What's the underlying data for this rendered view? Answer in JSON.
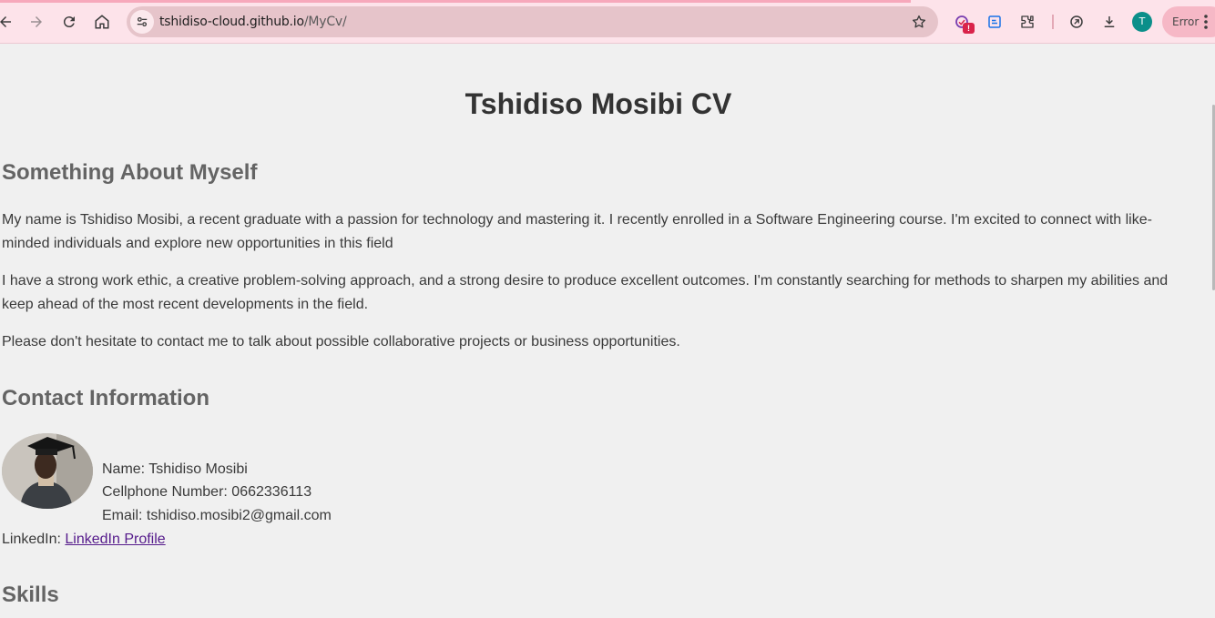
{
  "browser": {
    "url_host": "tshidiso-cloud.github.io",
    "url_path": "/MyCv/",
    "profile_initial": "T",
    "error_label": "Error",
    "extension_badge": "!"
  },
  "page": {
    "title": "Tshidiso Mosibi CV",
    "about": {
      "heading": "Something About Myself",
      "paragraphs": [
        "My name is Tshidiso Mosibi, a recent graduate with a passion for technology and mastering it. I recently enrolled in a Software Engineering course. I'm excited to connect with like-minded individuals and explore new opportunities in this field",
        "I have a strong work ethic, a creative problem-solving approach, and a strong desire to produce excellent outcomes. I'm constantly searching for methods to sharpen my abilities and keep ahead of the most recent developments in the field.",
        "Please don't hesitate to contact me to talk about possible collaborative projects or business opportunities."
      ]
    },
    "contact": {
      "heading": "Contact Information",
      "name": "Name: Tshidiso Mosibi",
      "cellphone": "Cellphone Number: 0662336113",
      "email": "Email: tshidiso.mosibi2@gmail.com",
      "linkedin_label": "LinkedIn: ",
      "linkedin_link": "LinkedIn Profile"
    },
    "skills": {
      "heading": "Skills"
    }
  },
  "colors": {
    "toolbar_bg": "#fde3ea",
    "omnibox_bg": "#e6c4ca",
    "page_bg": "#f0f0f0",
    "heading_gray": "#646464",
    "visited_link": "#551a8b"
  }
}
